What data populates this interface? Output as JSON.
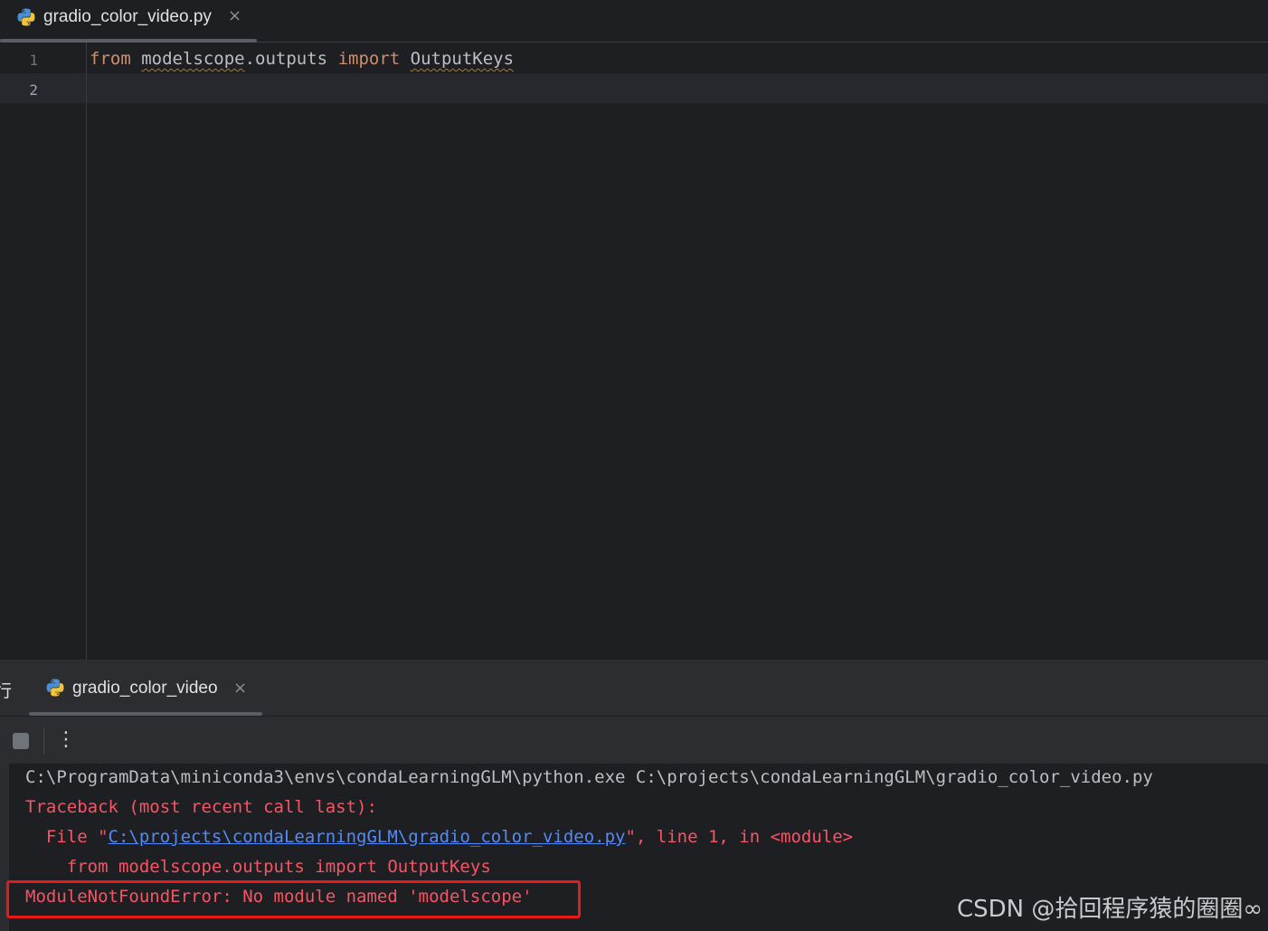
{
  "editor": {
    "tab": {
      "label": "gradio_color_video.py",
      "close": "×",
      "icon": "python-icon"
    },
    "line_numbers": [
      "1",
      "2"
    ],
    "code": {
      "line1": {
        "kw_from": "from",
        "module": "modelscope",
        "rest": ".outputs ",
        "kw_import": "import",
        "name": "OutputKeys"
      }
    }
  },
  "run_panel": {
    "side_glyph": "行",
    "tab": {
      "label": "gradio_color_video",
      "close": "×",
      "icon": "python-icon"
    },
    "toolbar": {
      "stop": "stop-icon",
      "more": "⋮"
    },
    "console": {
      "command": "C:\\ProgramData\\miniconda3\\envs\\condaLearningGLM\\python.exe C:\\projects\\condaLearningGLM\\gradio_color_video.py",
      "traceback_header": "Traceback (most recent call last):",
      "file_prefix": "  File \"",
      "file_link": "C:\\projects\\condaLearningGLM\\gradio_color_video.py",
      "file_suffix": "\", line 1, in <module>",
      "source_line": "    from modelscope.outputs import OutputKeys",
      "error": "ModuleNotFoundError: No module named 'modelscope'"
    }
  },
  "watermark": "CSDN @拾回程序猿的圈圈∞",
  "colors": {
    "background": "#1e1f22",
    "keyword": "#cf8e6d",
    "error": "#f75464",
    "link": "#548af7",
    "highlight": "#e8191b"
  }
}
